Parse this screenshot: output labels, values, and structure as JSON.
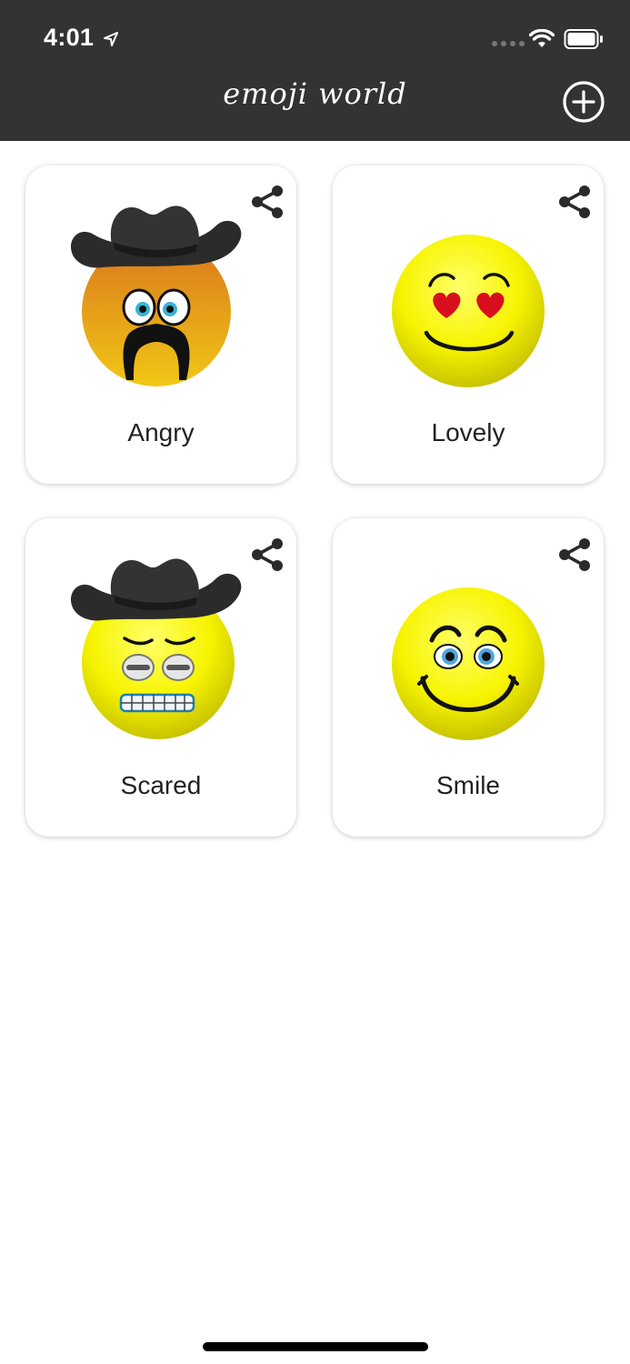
{
  "status_bar": {
    "time": "4:01",
    "icons": [
      "location-arrow-icon",
      "signal-icon",
      "wifi-icon",
      "battery-icon"
    ]
  },
  "header": {
    "title": "emoji world",
    "add_icon": "plus-circle-icon",
    "background": "#333333"
  },
  "emojis": [
    {
      "label": "Angry",
      "face": "orange-face-with-cowboy-hat-and-mustache"
    },
    {
      "label": "Lovely",
      "face": "yellow-face-with-heart-eyes"
    },
    {
      "label": "Scared",
      "face": "yellow-face-with-cowboy-hat-and-grimace"
    },
    {
      "label": "Smile",
      "face": "yellow-smiling-face"
    }
  ],
  "share_icon": "share-icon"
}
